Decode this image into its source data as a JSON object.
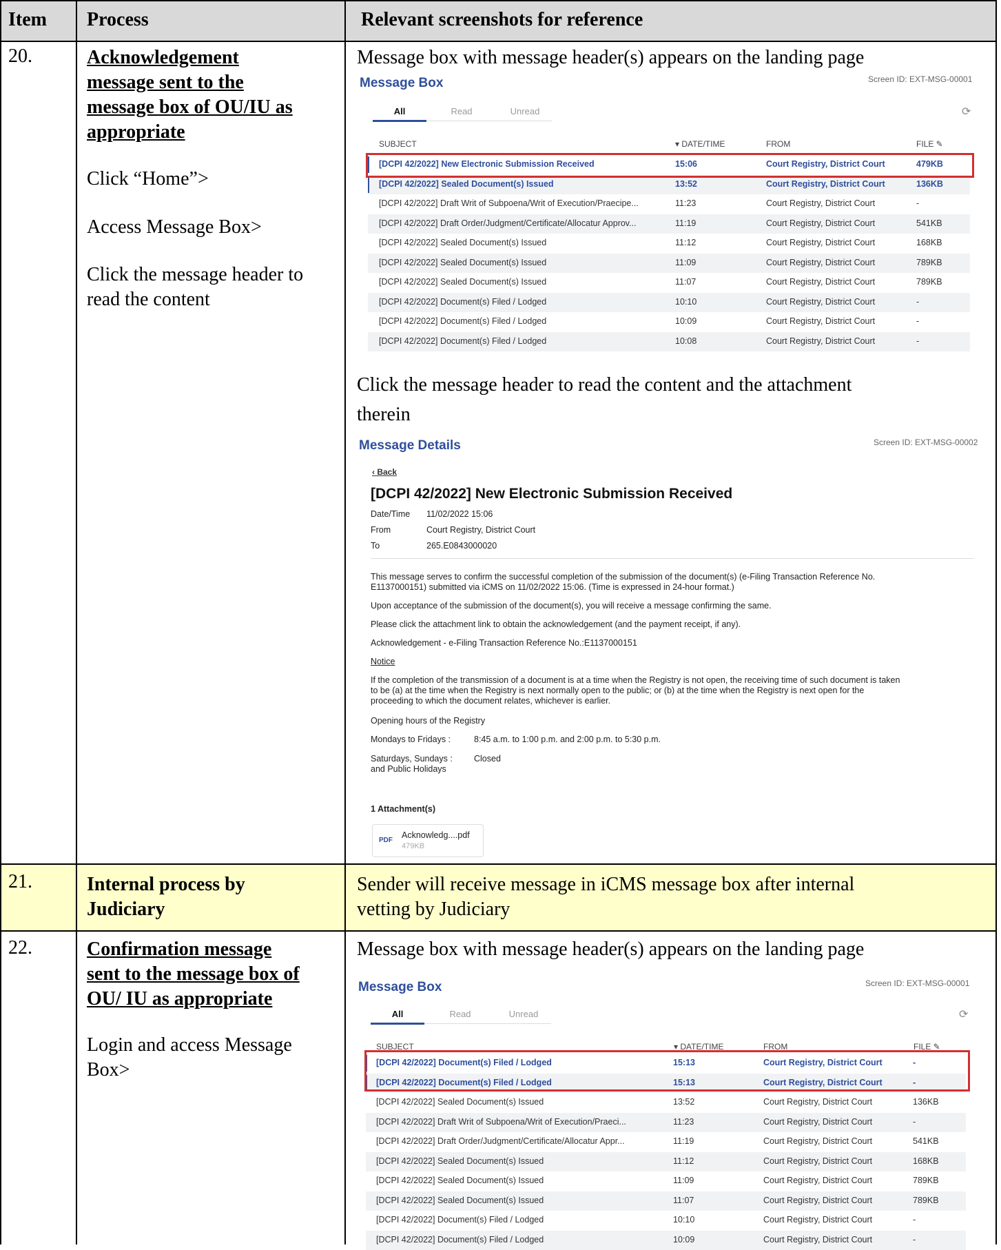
{
  "table_header": {
    "item": "Item",
    "process": "Process",
    "screenshots": "Relevant screenshots for reference"
  },
  "rows": [
    {
      "item": "20.",
      "title_lines": [
        "Acknowledgement",
        "message sent to the",
        "message box of OU/IU as",
        "appropriate"
      ],
      "steps": [
        "Click “Home”>",
        "Access Message Box>",
        "Click the message header to",
        "read the content"
      ],
      "caption1": "Message box with message header(s) appears on the landing page",
      "caption2_line1": "Click the message header to read the content and the attachment",
      "caption2_line2": "therein"
    },
    {
      "item": "21.",
      "title_lines": [
        "Internal process by",
        "Judiciary"
      ],
      "caption_line1": "Sender will receive message in iCMS message box after internal",
      "caption_line2": "vetting by Judiciary"
    },
    {
      "item": "22.",
      "title_lines": [
        "Confirmation message",
        "sent to the message box of",
        "OU/ IU as appropriate"
      ],
      "steps": [
        "Login and access Message",
        "Box>"
      ],
      "caption1": "Message box with message header(s) appears on the landing page"
    }
  ],
  "message_box_1": {
    "title": "Message Box",
    "screen_id": "Screen ID: EXT-MSG-00001",
    "tabs": [
      "All",
      "Read",
      "Unread"
    ],
    "columns": {
      "subject": "SUBJECT",
      "datetime": "▾ DATE/TIME",
      "from": "FROM",
      "file": "FILE ✎"
    },
    "messages": [
      {
        "subject": "[DCPI 42/2022] New Electronic Submission Received",
        "time": "15:06",
        "from": "Court Registry, District Court",
        "file": "479KB",
        "unread": true
      },
      {
        "subject": "[DCPI 42/2022] Sealed Document(s) Issued",
        "time": "13:52",
        "from": "Court Registry, District Court",
        "file": "136KB",
        "unread": true
      },
      {
        "subject": "[DCPI 42/2022] Draft Writ of Subpoena/Writ of Execution/Praecipe...",
        "time": "11:23",
        "from": "Court Registry, District Court",
        "file": "-",
        "unread": false
      },
      {
        "subject": "[DCPI 42/2022] Draft Order/Judgment/Certificate/Allocatur Approv...",
        "time": "11:19",
        "from": "Court Registry, District Court",
        "file": "541KB",
        "unread": false
      },
      {
        "subject": "[DCPI 42/2022] Sealed Document(s) Issued",
        "time": "11:12",
        "from": "Court Registry, District Court",
        "file": "168KB",
        "unread": false
      },
      {
        "subject": "[DCPI 42/2022] Sealed Document(s) Issued",
        "time": "11:09",
        "from": "Court Registry, District Court",
        "file": "789KB",
        "unread": false
      },
      {
        "subject": "[DCPI 42/2022] Sealed Document(s) Issued",
        "time": "11:07",
        "from": "Court Registry, District Court",
        "file": "789KB",
        "unread": false
      },
      {
        "subject": "[DCPI 42/2022] Document(s) Filed / Lodged",
        "time": "10:10",
        "from": "Court Registry, District Court",
        "file": "-",
        "unread": false
      },
      {
        "subject": "[DCPI 42/2022] Document(s) Filed / Lodged",
        "time": "10:09",
        "from": "Court Registry, District Court",
        "file": "-",
        "unread": false
      },
      {
        "subject": "[DCPI 42/2022] Document(s) Filed / Lodged",
        "time": "10:08",
        "from": "Court Registry, District Court",
        "file": "-",
        "unread": false
      }
    ]
  },
  "message_details": {
    "title": "Message Details",
    "screen_id": "Screen ID: EXT-MSG-00002",
    "back": "‹ Back",
    "heading": "[DCPI 42/2022]  New Electronic Submission Received",
    "meta": [
      {
        "label": "Date/Time",
        "value": "11/02/2022 15:06"
      },
      {
        "label": "From",
        "value": "Court Registry, District Court"
      },
      {
        "label": "To",
        "value": "265.E0843000020"
      }
    ],
    "body_1a": "This message serves to confirm the successful completion of the submission of the document(s) (e-Filing Transaction Reference No.",
    "body_1b": "E1137000151) submitted via iCMS on 11/02/2022 15:06. (Time is expressed in 24-hour format.)",
    "body_2": "Upon acceptance of the submission of the document(s), you will receive a message confirming the same.",
    "body_3": "Please click the attachment link to obtain the acknowledgement (and the payment receipt, if any).",
    "body_4": "Acknowledgement - e-Filing Transaction Reference No.:E1137000151",
    "notice_label": "Notice",
    "notice_a": "If the completion of the transmission of a document is at a time when the Registry is not open, the receiving time of such document is taken",
    "notice_b": "to be (a) at the time when the Registry is next normally open to the public; or (b) at the time when the Registry is next open for the",
    "notice_c": "proceeding to which the document relates, whichever is earlier.",
    "opening_hours": "Opening hours of the Registry",
    "weekdays_label": "Mondays to Fridays   :",
    "weekdays_value": "8:45 a.m. to 1:00 p.m. and 2:00 p.m. to 5:30 p.m.",
    "weekend_label_a": "Saturdays, Sundays   :",
    "weekend_label_b": "and Public Holidays",
    "weekend_value": "Closed",
    "attachments_title": "1 Attachment(s)",
    "attachment_icon": "PDF",
    "attachment_name": "Acknowledg....pdf",
    "attachment_size": "479KB"
  },
  "message_box_2": {
    "title": "Message Box",
    "screen_id": "Screen ID: EXT-MSG-00001",
    "tabs": [
      "All",
      "Read",
      "Unread"
    ],
    "columns": {
      "subject": "SUBJECT",
      "datetime": "▾ DATE/TIME",
      "from": "FROM",
      "file": "FILE ✎"
    },
    "messages": [
      {
        "subject": "[DCPI 42/2022] Document(s) Filed / Lodged",
        "time": "15:13",
        "from": "Court Registry, District Court",
        "file": "-",
        "unread": true
      },
      {
        "subject": "[DCPI 42/2022] Document(s) Filed / Lodged",
        "time": "15:13",
        "from": "Court Registry, District Court",
        "file": "-",
        "unread": true
      },
      {
        "subject": "[DCPI 42/2022] Sealed Document(s) Issued",
        "time": "13:52",
        "from": "Court Registry, District Court",
        "file": "136KB",
        "unread": false
      },
      {
        "subject": "[DCPI 42/2022] Draft Writ of Subpoena/Writ of Execution/Praeci...",
        "time": "11:23",
        "from": "Court Registry, District Court",
        "file": "-",
        "unread": false
      },
      {
        "subject": "[DCPI 42/2022] Draft Order/Judgment/Certificate/Allocatur Appr...",
        "time": "11:19",
        "from": "Court Registry, District Court",
        "file": "541KB",
        "unread": false
      },
      {
        "subject": "[DCPI 42/2022] Sealed Document(s) Issued",
        "time": "11:12",
        "from": "Court Registry, District Court",
        "file": "168KB",
        "unread": false
      },
      {
        "subject": "[DCPI 42/2022] Sealed Document(s) Issued",
        "time": "11:09",
        "from": "Court Registry, District Court",
        "file": "789KB",
        "unread": false
      },
      {
        "subject": "[DCPI 42/2022] Sealed Document(s) Issued",
        "time": "11:07",
        "from": "Court Registry, District Court",
        "file": "789KB",
        "unread": false
      },
      {
        "subject": "[DCPI 42/2022] Document(s) Filed / Lodged",
        "time": "10:10",
        "from": "Court Registry, District Court",
        "file": "-",
        "unread": false
      },
      {
        "subject": "[DCPI 42/2022] Document(s) Filed / Lodged",
        "time": "10:09",
        "from": "Court Registry, District Court",
        "file": "-",
        "unread": false
      }
    ]
  }
}
